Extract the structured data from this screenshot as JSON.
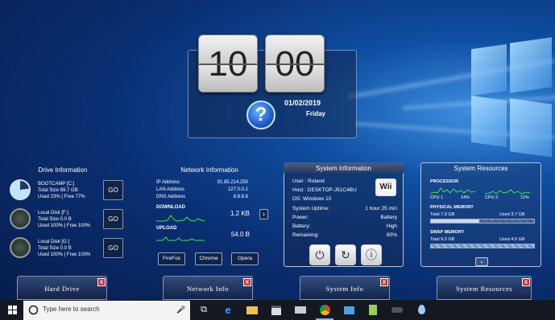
{
  "clock": {
    "hours": "10",
    "minutes": "00",
    "date": "01/02/2019",
    "day": "Friday",
    "help_glyph": "?"
  },
  "drive": {
    "title": "Drive Information",
    "go_label": "GO",
    "disks": [
      {
        "name": "BOOTCAMP [C:]",
        "total": "Total Size  89.7 GB",
        "used": "Used 23%   |   Free 77%",
        "used_percent": 23
      },
      {
        "name": "Local Disk [F:]",
        "total": "Total Size  0.0 B",
        "used": "Used 100%   |   Free 100%",
        "used_percent": 100
      },
      {
        "name": "Local Disk [G:]",
        "total": "Total Size  0.0 B",
        "used": "Used 100%   |   Free 100%",
        "used_percent": 100
      }
    ]
  },
  "network": {
    "title": "Network Information",
    "ip_label": "IP Address",
    "ip_value": "91.85.214.250",
    "lan_label": "LAN Address",
    "lan_value": "127.0.0.1",
    "dns_label": "DNS Address",
    "dns_value": "8.8.8.8",
    "download_label": "DOWNLOAD",
    "download_value": "1.2 KB",
    "upload_label": "UPLOAD",
    "upload_value": "54.0 B",
    "next_glyph": "›",
    "browsers": [
      "FireFox",
      "Chrome",
      "Opera"
    ]
  },
  "system": {
    "title": "System Information",
    "user": "User : Roland",
    "host": "Host : DESKTOP-J51C4BU",
    "os": "OS: Windows 10",
    "uptime_label": "System Uptime:",
    "uptime_value": "1 hour 25 min",
    "power_label": "Power:",
    "power_value": "Battery",
    "battery_label": "Battery:",
    "battery_value": "High",
    "remaining_label": "Remaining:",
    "remaining_value": "60%",
    "badge": "Wii",
    "power_icon": "⏻",
    "restart_icon": "↻",
    "info_icon": "ⓘ"
  },
  "resources": {
    "title": "System Resources",
    "processor": "PROCESSOR",
    "cpu1_label": "CPU 1",
    "cpu1_value": "14%",
    "cpu2_label": "CPU 2",
    "cpu2_value": "11%",
    "physical": "PHYSICAL MEMORY",
    "physical_total": "Total 7.9 GB",
    "physical_used": "Used 3.7 GB",
    "physical_fraction": 0.47,
    "swap": "SWAP MEMORY",
    "swap_total": "Total 9.2 GB",
    "swap_used": "Used 4.5 GB",
    "more_glyph": "⌄"
  },
  "tabs": [
    {
      "label": "Hard Drive"
    },
    {
      "label": "Network Info"
    },
    {
      "label": "System Info"
    },
    {
      "label": "System Resources"
    }
  ],
  "tab_close": "x",
  "taskbar": {
    "start_icon": "windows-start-icon",
    "search_placeholder": "Type here to search",
    "mic_glyph": "🎤",
    "task_view_glyph": "⧉",
    "edge_glyph": "e"
  }
}
